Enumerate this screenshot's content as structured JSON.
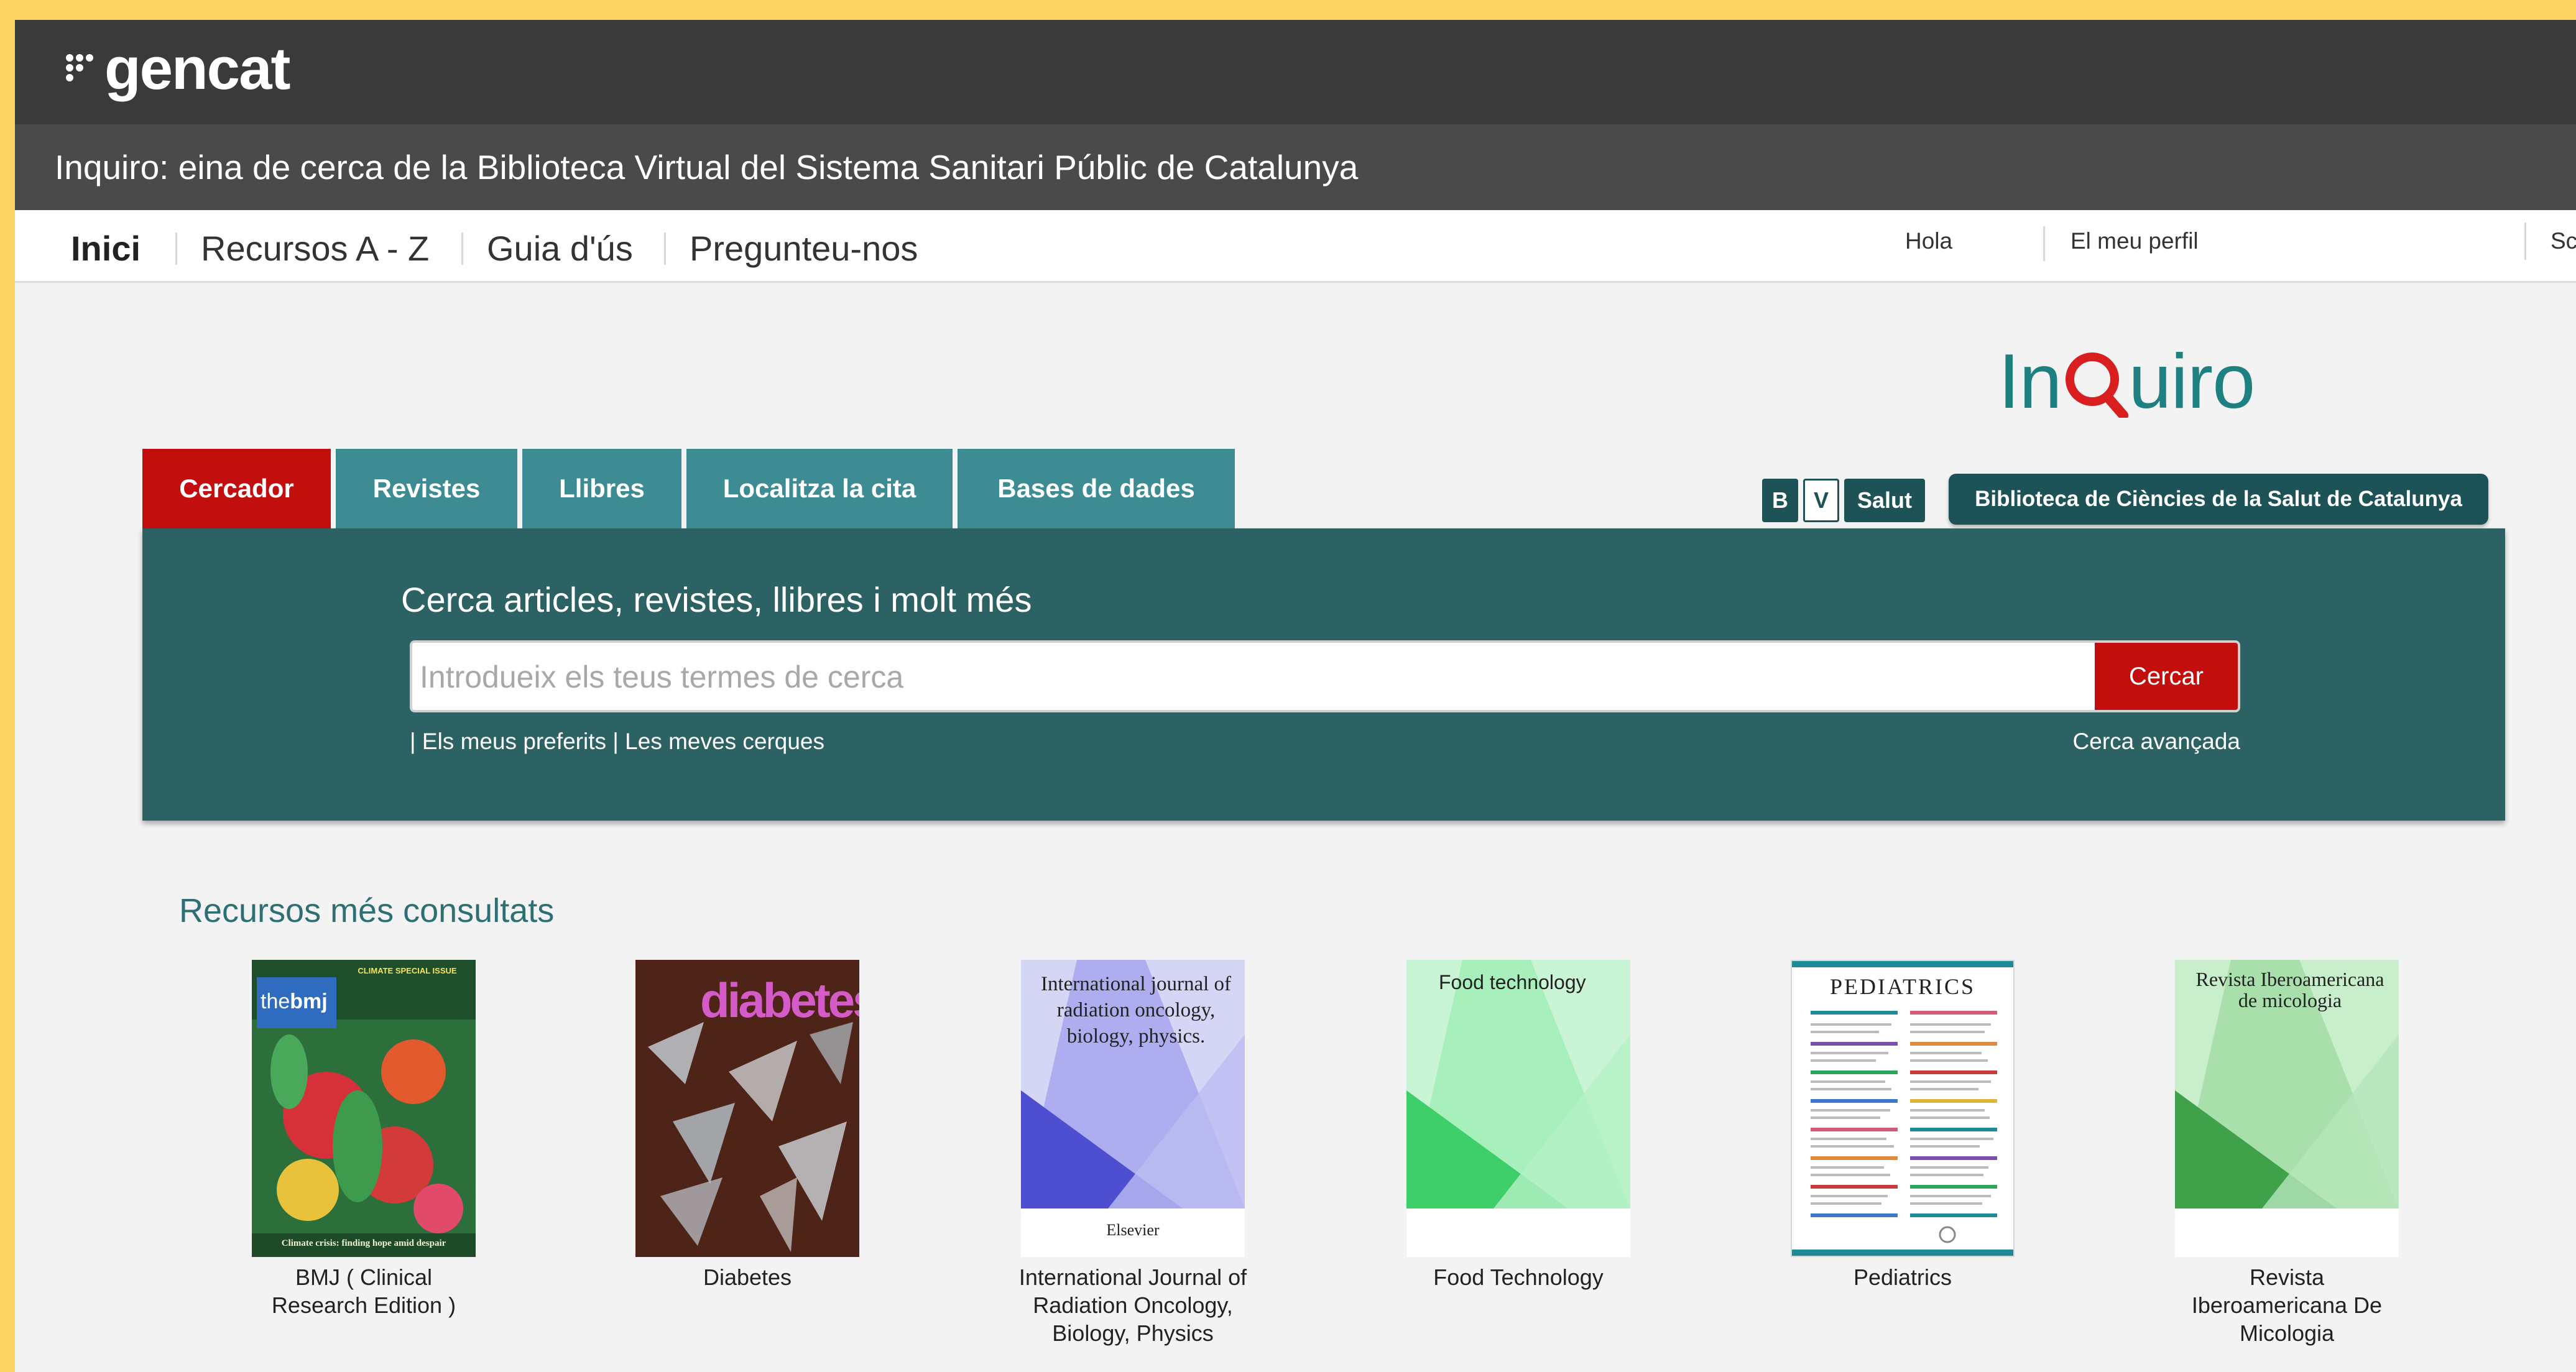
{
  "header": {
    "logo_text": "gencat",
    "subtitle": "Inquiro: eina de cerca de la Biblioteca Virtual del Sistema Sanitari Públic de Catalunya"
  },
  "nav": {
    "items": [
      "Inici",
      "Recursos A - Z",
      "Guia d'ús",
      "Pregunteu-nos"
    ],
    "right": [
      "Hola",
      "El meu perfil",
      "Sc"
    ]
  },
  "brand": {
    "logo_in": "In",
    "logo_uiro": "uiro",
    "bvs_b": "B",
    "bvs_v": "V",
    "bvs_salut": "Salut",
    "library_name": "Biblioteca de Ciències de la Salut de Catalunya"
  },
  "tabs": [
    "Cercador",
    "Revistes",
    "Llibres",
    "Localitza la cita",
    "Bases de dades"
  ],
  "search": {
    "heading": "Cerca articles, revistes, llibres i molt més",
    "placeholder": "Introdueix els teus termes de cerca",
    "button": "Cercar",
    "favorites": "Els meus preferits",
    "my_searches": "Les meves cerques",
    "advanced": "Cerca avançada"
  },
  "resources": {
    "heading": "Recursos més consultats",
    "items": [
      {
        "title": "BMJ ( Clinical Research Edition )",
        "cover_brand": "bmj",
        "cover_caption": "Climate crisis: finding hope amid despair",
        "cover_tag": "CLIMATE SPECIAL ISSUE"
      },
      {
        "title": "Diabetes",
        "cover_brand": "diabetes"
      },
      {
        "title": "International Journal of Radiation Oncology, Biology, Physics",
        "cover_text": "International journal of radiation oncology, biology, physics.",
        "cover_publisher": "Elsevier"
      },
      {
        "title": "Food Technology",
        "cover_text": "Food technology"
      },
      {
        "title": "Pediatrics",
        "cover_text": "PEDIATRICS"
      },
      {
        "title": "Revista Iberoamericana De Micologia",
        "cover_text": "Revista Iberoamericana de micologia"
      }
    ]
  }
}
